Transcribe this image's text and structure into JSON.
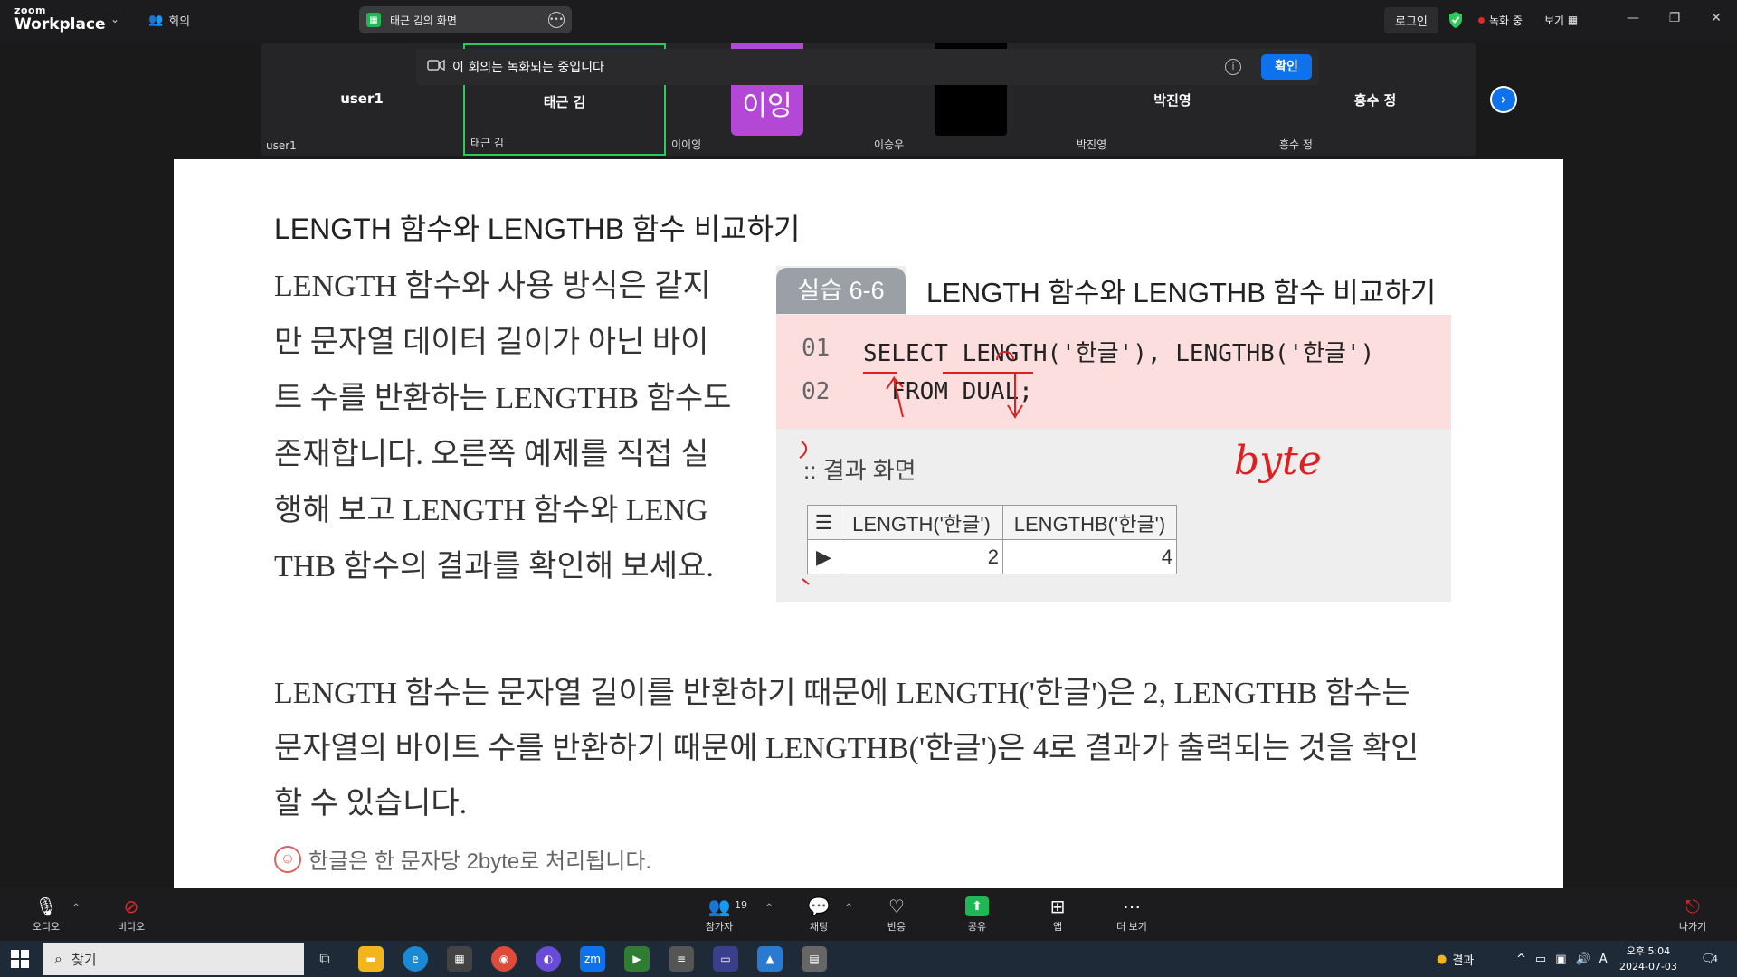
{
  "topbar": {
    "logo_small": "zoom",
    "logo_big": "Workplace",
    "meeting_label": "회의",
    "share_title": "태근 김의 화면",
    "login": "로그인",
    "recording": "녹화 중",
    "view": "보기"
  },
  "participants": [
    {
      "name": "user1",
      "label": "user1"
    },
    {
      "name": "태근 김",
      "label": "태근 김"
    },
    {
      "name": "",
      "label": "이이잉"
    },
    {
      "name": "",
      "label": "이승우"
    },
    {
      "name": "박진영",
      "label": "박진영"
    },
    {
      "name": "흥수 정",
      "label": "흥수 정"
    }
  ],
  "avatar_text": "이잉",
  "banner": {
    "text": "이 회의는 녹화되는 중입니다",
    "confirm": "확인"
  },
  "slide": {
    "title": "LENGTH 함수와 LENGTHB 함수 비교하기",
    "para_lines": [
      "LENGTH 함수와 사용 방식은 같지",
      "만 문자열 데이터 길이가 아닌 바이",
      "트 수를 반환하는 LENGTHB 함수도",
      "존재합니다. 오른쪽 예제를 직접 실",
      "행해 보고 LENGTH 함수와 LENG",
      "THB 함수의 결과를 확인해 보세요."
    ],
    "lab_tag": "실습 6-6",
    "lab_title": "LENGTH 함수와 LENGTHB 함수 비교하기",
    "code": [
      {
        "ln": "01",
        "text": "SELECT LENGTH('한글'), LENGTHB('한글')"
      },
      {
        "ln": "02",
        "text": "  FROM DUAL;"
      }
    ],
    "result_label": ":: 결과 화면",
    "table": {
      "headers": [
        "LENGTH('한글')",
        "LENGTHB('한글')"
      ],
      "row": [
        "2",
        "4"
      ]
    },
    "para2_lines": [
      "LENGTH 함수는 문자열 길이를 반환하기 때문에 LENGTH('한글')은 2, LENGTHB 함수는",
      "문자열의 바이트 수를 반환하기 때문에 LENGTHB('한글')은 4로 결과가 출력되는 것을 확인",
      "할 수 있습니다."
    ],
    "tip": "한글은 한 문자당 2byte로 처리됩니다.",
    "annotation": "byte"
  },
  "toolbar": {
    "audio": "오디오",
    "video": "비디오",
    "participants": "참가자",
    "participant_count": "19",
    "chat": "채팅",
    "reactions": "반응",
    "share": "공유",
    "apps": "앱",
    "more": "더 보기",
    "leave": "나가기"
  },
  "taskbar": {
    "search": "찾기",
    "weather": "결과",
    "ime": "A",
    "time": "오후 5:04",
    "date": "2024-07-03",
    "notif_count": "4",
    "zoom_app": "zm"
  },
  "colors": {
    "zoom_blue": "#0e72ed",
    "active_green": "#2ec95b",
    "record_red": "#e02828",
    "code_bg": "#fbdedd",
    "annotation_red": "#e02020"
  }
}
